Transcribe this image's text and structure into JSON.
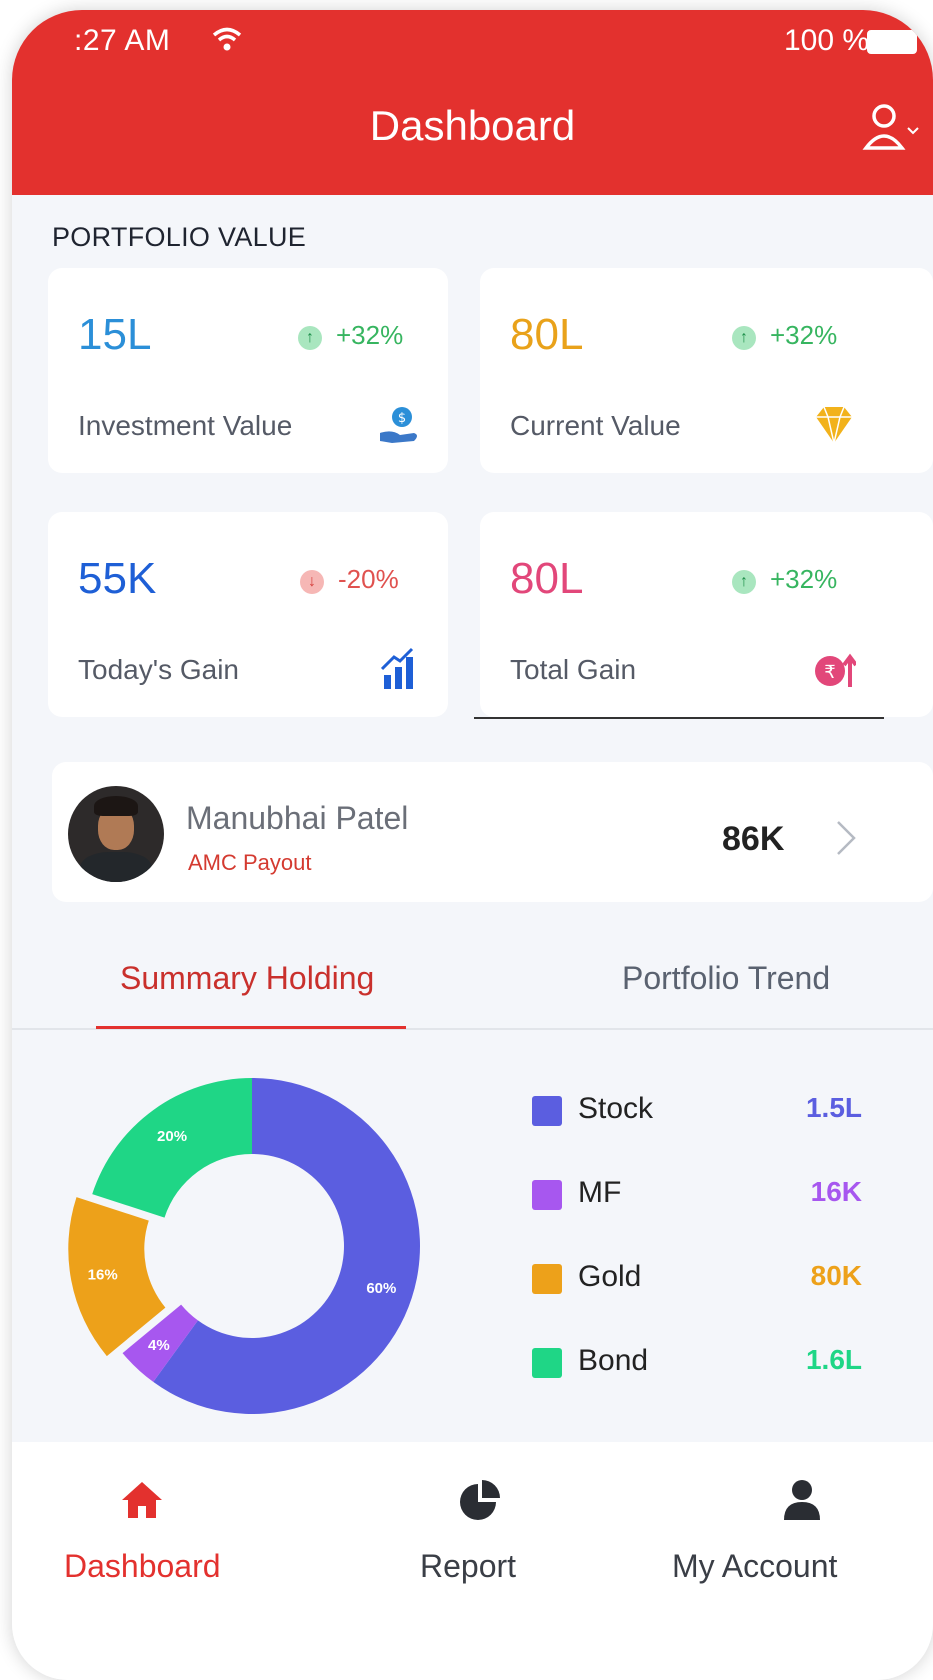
{
  "status_bar": {
    "time": ":27 AM",
    "battery": "100 %"
  },
  "header": {
    "title": "Dashboard"
  },
  "portfolio": {
    "section_label": "PORTFOLIO VALUE",
    "cards": [
      {
        "value": "15L",
        "change": "+32%",
        "direction": "up",
        "label": "Investment Value",
        "value_color": "#2b8fd8",
        "icon": "money-hand-icon"
      },
      {
        "value": "80L",
        "change": "+32%",
        "direction": "up",
        "label": "Current Value",
        "value_color": "#e9a21a",
        "icon": "diamond-icon"
      },
      {
        "value": "55K",
        "change": "-20%",
        "direction": "down",
        "label": "Today's Gain",
        "value_color": "#1e5fd6",
        "icon": "bar-chart-up-icon"
      },
      {
        "value": "80L",
        "change": "+32%",
        "direction": "up",
        "label": "Total Gain",
        "value_color": "#e2477a",
        "icon": "rupee-up-icon"
      }
    ]
  },
  "payout": {
    "name": "Manubhai Patel",
    "subtitle": "AMC Payout",
    "amount": "86K"
  },
  "tabs": {
    "active": "Summary Holding",
    "inactive": "Portfolio Trend"
  },
  "chart_data": {
    "type": "pie",
    "categories": [
      "Stock",
      "MF",
      "Gold",
      "Bond"
    ],
    "values": [
      60,
      4,
      16,
      20
    ],
    "slice_labels": [
      "60%",
      "4%",
      "16%",
      "20%"
    ],
    "legend_values": [
      "1.5L",
      "16K",
      "80K",
      "1.6L"
    ],
    "colors": [
      "#5b5ee0",
      "#a757ef",
      "#eda11a",
      "#1fd686"
    ],
    "donut": true,
    "legend_position": "right"
  },
  "bottom_nav": [
    {
      "label": "Dashboard",
      "icon": "home-icon",
      "active": true
    },
    {
      "label": "Report",
      "icon": "pie-chart-icon",
      "active": false
    },
    {
      "label": "My Account",
      "icon": "user-icon",
      "active": false
    }
  ],
  "colors": {
    "primary": "#e3312e",
    "background": "#f4f6fa",
    "positive": "#37b560",
    "negative": "#e0524f"
  }
}
